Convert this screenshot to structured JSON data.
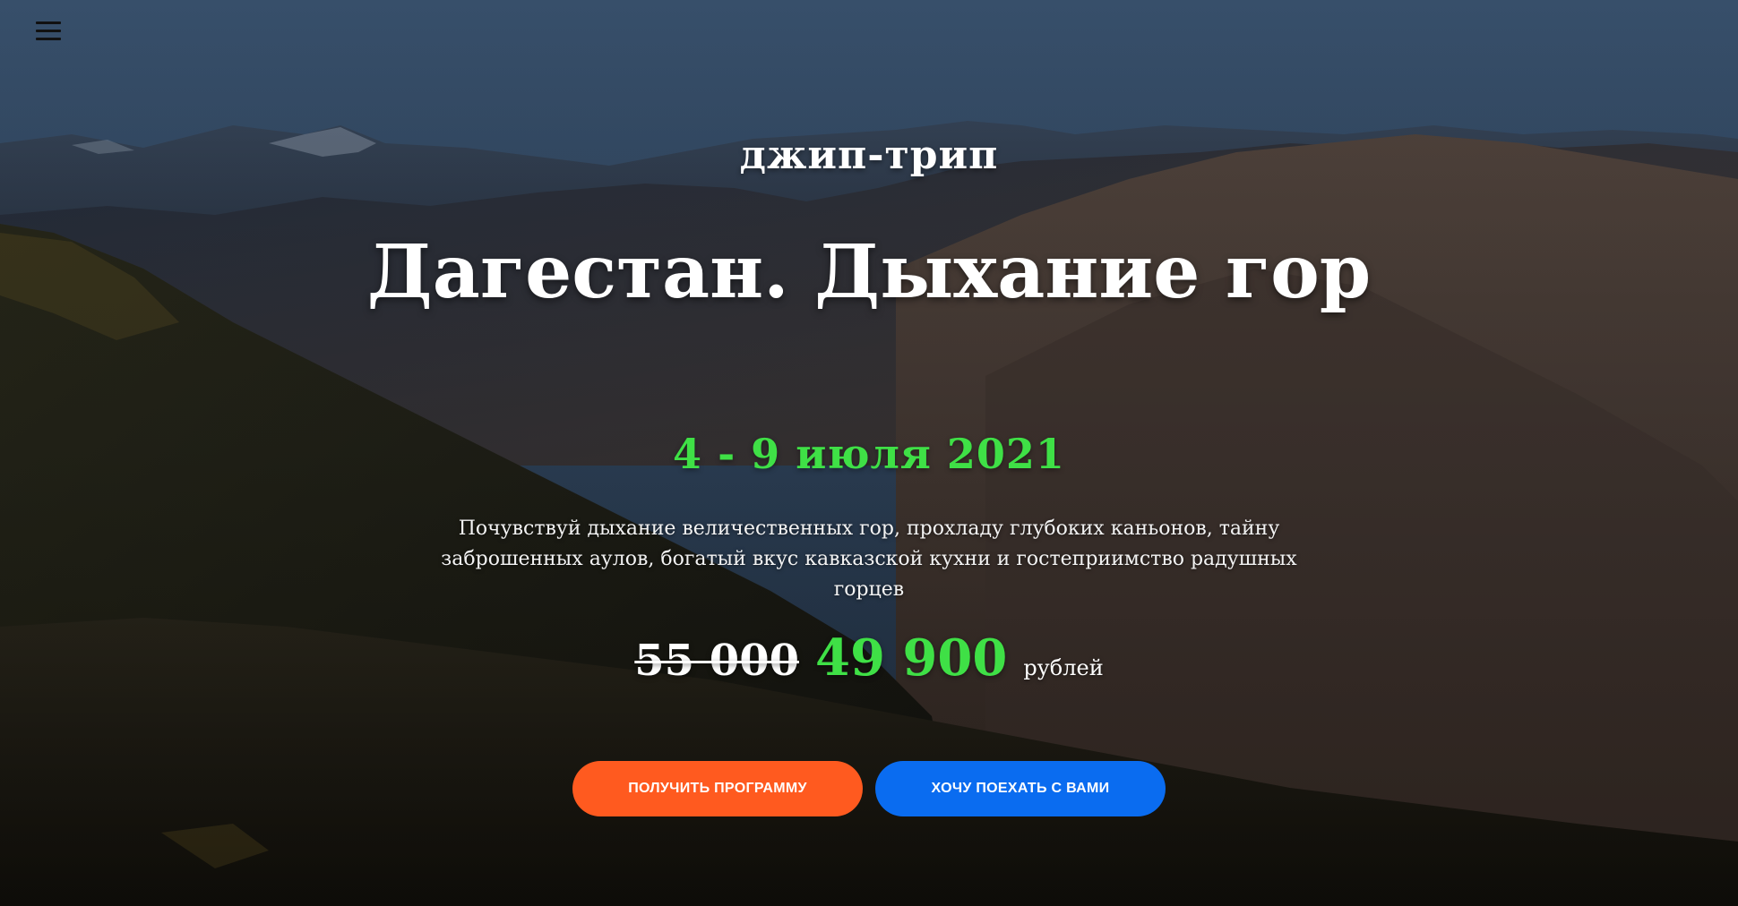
{
  "header": {
    "menu_icon": "hamburger-menu-icon"
  },
  "hero": {
    "subtitle": "джип-трип",
    "title": "Дагестан. Дыхание гор",
    "dates": "4 - 9 июля 2021",
    "description_line1": "Почувствуй дыхание величественных гор, прохладу глубоких каньонов, тайну",
    "description_line2": "заброшенных аулов, богатый вкус кавказской кухни и гостеприимство радушных горцев",
    "old_price": "55 000",
    "new_price": "49 900",
    "currency": "рублей"
  },
  "buttons": {
    "get_program": "ПОЛУЧИТЬ ПРОГРАММУ",
    "join": "ХОЧУ ПОЕХАТЬ С ВАМИ"
  },
  "colors": {
    "accent_green": "#3fe046",
    "button_orange": "#ff5a1f",
    "button_blue": "#0a6cf0"
  }
}
